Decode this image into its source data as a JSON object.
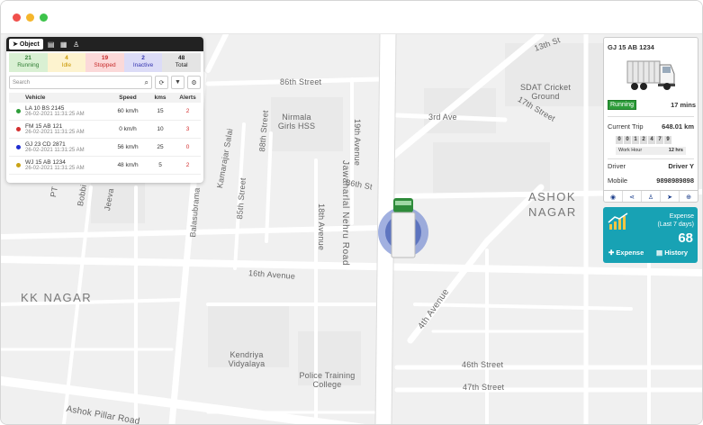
{
  "map": {
    "streets": [
      "13th St",
      "86th Street",
      "3rd Ave",
      "17th Street",
      "86th St",
      "16th Avenue",
      "46th Street",
      "47th Street",
      "Ashok Pillar Road",
      "4th Avenue",
      "Jawaharlal Nehru Road",
      "19th Avenue",
      "18th Avenue",
      "88th Street",
      "85th Street",
      "Kamarajar Salai",
      "Balasubrama",
      "Jeeva",
      "Bobbi",
      "PT"
    ],
    "places": [
      "SDAT Cricket Ground",
      "Nirmala Girls HSS",
      "Kendriya Vidyalaya",
      "Police Training College"
    ],
    "areas": [
      "ASHOK NAGAR",
      "KK NAGAR"
    ]
  },
  "object_panel": {
    "active_tab": "Object",
    "tab_icons": [
      "navigation-icon",
      "document-icon",
      "grid-icon",
      "person-icon"
    ],
    "stats": [
      {
        "count": "21",
        "label": "Running",
        "bg": "#d9f0d3",
        "color": "#2e7d32"
      },
      {
        "count": "4",
        "label": "Idle",
        "bg": "#fdf3cf",
        "color": "#c99700"
      },
      {
        "count": "19",
        "label": "Stopped",
        "bg": "#fbd9d9",
        "color": "#c62828"
      },
      {
        "count": "2",
        "label": "Inactive",
        "bg": "#dcdcf7",
        "color": "#3535b0"
      },
      {
        "count": "48",
        "label": "Total",
        "bg": "#e4e4e4",
        "color": "#222"
      }
    ],
    "search_placeholder": "Search",
    "columns": {
      "vehicle": "Vehicle",
      "speed": "Speed",
      "kms": "kms",
      "alerts": "Alerts"
    },
    "rows": [
      {
        "name": "LA 10 BS 2145",
        "time": "26-02-2021 11:31:25 AM",
        "speed": "60 km/h",
        "kms": "15",
        "alerts": "2",
        "dot": "#2e9d3a"
      },
      {
        "name": "FM 15 AB 121",
        "time": "26-02-2021 11:31:25 AM",
        "speed": "0 km/h",
        "kms": "10",
        "alerts": "3",
        "dot": "#d32f2f"
      },
      {
        "name": "GJ 23 CD 2871",
        "time": "26-02-2021 11:31:25 AM",
        "speed": "56 km/h",
        "kms": "25",
        "alerts": "0",
        "dot": "#1f2ccf"
      },
      {
        "name": "WJ 15 AB 1234",
        "time": "26-02-2021 11:31:25 AM",
        "speed": "48 km/h",
        "kms": "5",
        "alerts": "2",
        "dot": "#c9a316"
      }
    ]
  },
  "vehicle_panel": {
    "title": "GJ 15 AB 1234",
    "status": "Running",
    "duration": "17 mins",
    "trip_label": "Current Trip",
    "trip_value": "648.01 km",
    "odometer": [
      "0",
      "0",
      "1",
      "2",
      "4",
      "7",
      "9"
    ],
    "work_hour_label": "Work Hour",
    "work_hour_value": "12 hrs",
    "driver_label": "Driver",
    "driver_value": "Driver Y",
    "mobile_label": "Mobile",
    "mobile_value": "9898989898",
    "action_icons": [
      "eye-icon",
      "share-icon",
      "person-icon",
      "navigate-icon",
      "zoom-icon"
    ]
  },
  "expense_card": {
    "title_line1": "Expense",
    "title_line2": "(Last 7 days)",
    "value": "68",
    "expense_button": "Expense",
    "history_button": "History"
  }
}
